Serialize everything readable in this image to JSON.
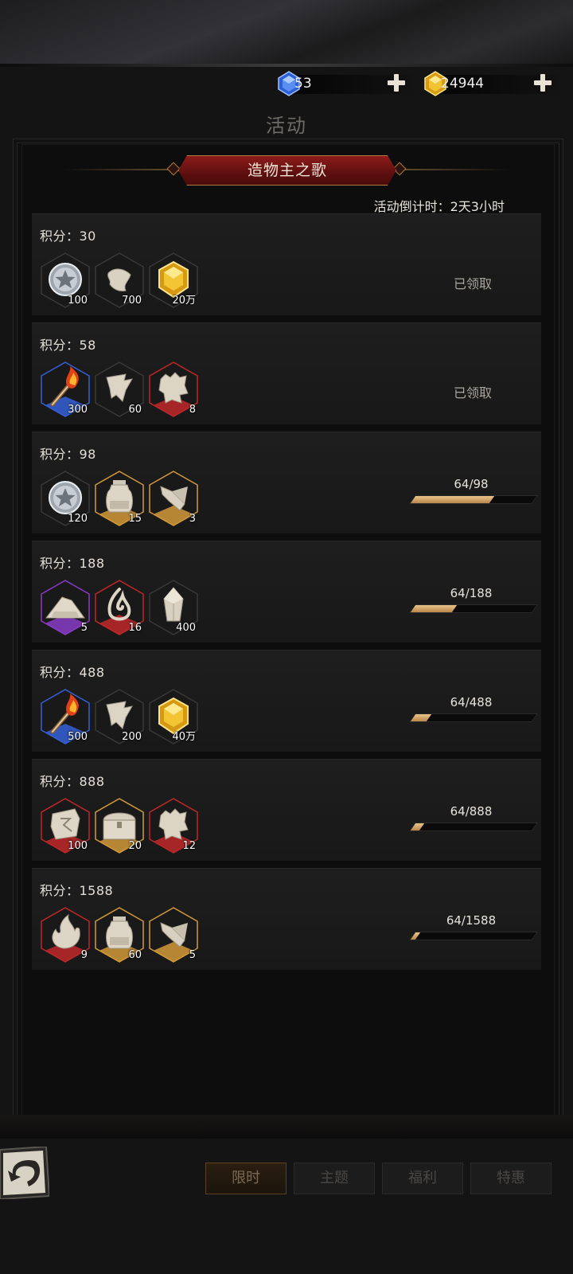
{
  "currencies": [
    {
      "name": "blue-gem",
      "value": "53",
      "color": "#3d73e6"
    },
    {
      "name": "gold-gem",
      "value": "24944",
      "color": "#e7b52a"
    }
  ],
  "page_title": "活动",
  "event": {
    "title": "造物主之歌",
    "countdown": "活动倒计时：2天3小时"
  },
  "score_prefix": "积分：",
  "rows": [
    {
      "score": "积分：30",
      "status": "已领取",
      "progress": null,
      "items": [
        {
          "icon": "silver-star-coin-icon",
          "qty": "100",
          "frame": "none"
        },
        {
          "icon": "cloth-scrap-icon",
          "qty": "700",
          "frame": "none"
        },
        {
          "icon": "gold-gem-icon",
          "qty": "20万",
          "frame": "none"
        }
      ]
    },
    {
      "score": "积分：58",
      "status": "已领取",
      "progress": null,
      "items": [
        {
          "icon": "torch-icon",
          "qty": "300",
          "frame": "blue"
        },
        {
          "icon": "torn-paper-icon",
          "qty": "60",
          "frame": "none"
        },
        {
          "icon": "ragged-cloth-icon",
          "qty": "8",
          "frame": "red"
        }
      ]
    },
    {
      "score": "积分：98",
      "status": "",
      "progress": {
        "text": "64/98",
        "current": 64,
        "max": 98
      },
      "items": [
        {
          "icon": "silver-star-coin-icon",
          "qty": "120",
          "frame": "none"
        },
        {
          "icon": "jar-icon",
          "qty": "15",
          "frame": "gold"
        },
        {
          "icon": "crystal-shard-icon",
          "qty": "3",
          "frame": "gold"
        }
      ]
    },
    {
      "score": "积分：188",
      "status": "",
      "progress": {
        "text": "64/188",
        "current": 64,
        "max": 188
      },
      "items": [
        {
          "icon": "stone-pile-icon",
          "qty": "5",
          "frame": "purple"
        },
        {
          "icon": "flame-swirl-icon",
          "qty": "16",
          "frame": "red"
        },
        {
          "icon": "crystal-icon",
          "qty": "400",
          "frame": "none"
        }
      ]
    },
    {
      "score": "积分：488",
      "status": "",
      "progress": {
        "text": "64/488",
        "current": 64,
        "max": 488
      },
      "items": [
        {
          "icon": "torch-icon",
          "qty": "500",
          "frame": "blue"
        },
        {
          "icon": "torn-paper-icon",
          "qty": "200",
          "frame": "none"
        },
        {
          "icon": "gold-gem-icon",
          "qty": "40万",
          "frame": "none"
        }
      ]
    },
    {
      "score": "积分：888",
      "status": "",
      "progress": {
        "text": "64/888",
        "current": 64,
        "max": 888
      },
      "items": [
        {
          "icon": "rune-stone-icon",
          "qty": "100",
          "frame": "red"
        },
        {
          "icon": "treasure-chest-icon",
          "qty": "20",
          "frame": "gold"
        },
        {
          "icon": "ragged-cloth-icon",
          "qty": "12",
          "frame": "red"
        }
      ]
    },
    {
      "score": "积分：1588",
      "status": "",
      "progress": {
        "text": "64/1588",
        "current": 64,
        "max": 1588
      },
      "items": [
        {
          "icon": "flame-icon",
          "qty": "9",
          "frame": "red"
        },
        {
          "icon": "jar-icon",
          "qty": "60",
          "frame": "gold"
        },
        {
          "icon": "crystal-shard-icon",
          "qty": "5",
          "frame": "gold"
        }
      ]
    }
  ],
  "tabs": [
    {
      "label": "限时",
      "active": true
    },
    {
      "label": "主题",
      "active": false
    },
    {
      "label": "福利",
      "active": false
    },
    {
      "label": "特惠",
      "active": false
    }
  ],
  "frame_colors": {
    "none": "#3a3836",
    "blue": "#3560d8",
    "red": "#c0282a",
    "gold": "#d39a3a",
    "purple": "#8a3cc8"
  }
}
